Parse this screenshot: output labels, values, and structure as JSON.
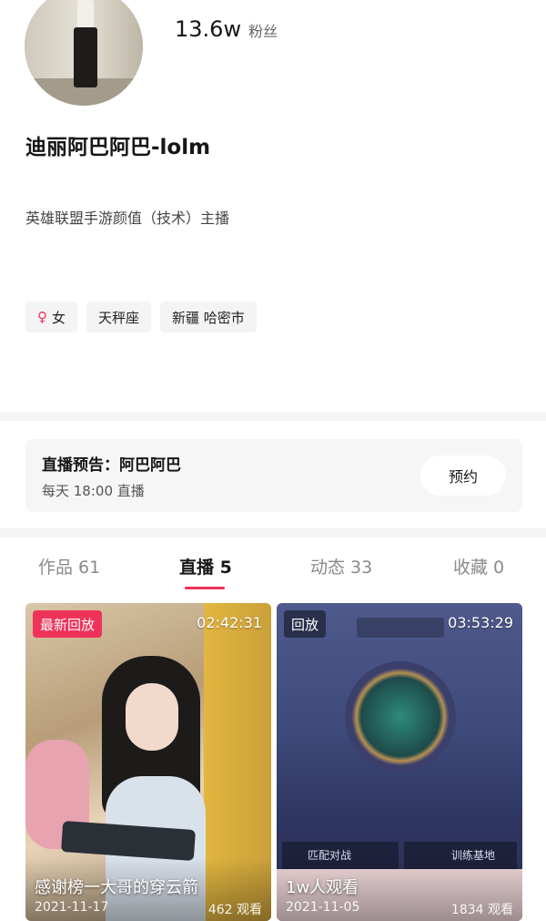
{
  "profile": {
    "followers_count": "13.6w",
    "followers_label": "粉丝",
    "nickname": "迪丽阿巴阿巴-lolm",
    "bio": "英雄联盟手游颜值（技术）主播",
    "tags": [
      {
        "icon": "female-icon",
        "label": "女"
      },
      {
        "label": "天秤座"
      },
      {
        "label": "新疆 哈密市"
      }
    ]
  },
  "live_notice": {
    "title": "直播预告：阿巴阿巴",
    "schedule": "每天 18:00 直播",
    "reserve_label": "预约"
  },
  "tabs": [
    {
      "label": "作品 61",
      "active": false
    },
    {
      "label": "直播 5",
      "active": true
    },
    {
      "label": "动态 33",
      "active": false
    },
    {
      "label": "收藏 0",
      "active": false
    }
  ],
  "cards": [
    {
      "badge": "最新回放",
      "duration": "02:42:31",
      "title": "感谢榜一大哥的穿云箭",
      "date": "2021-11-17",
      "views": "462 观看"
    },
    {
      "badge": "回放",
      "duration": "03:53:29",
      "title": "1w人观看",
      "date": "2021-11-05",
      "views": "1834 观看",
      "scene_labels": {
        "left": "匹配对战",
        "right": "训练基地"
      }
    }
  ],
  "colors": {
    "accent": "#f0325a",
    "text_primary": "#161616",
    "text_secondary": "#8a8a8a"
  }
}
